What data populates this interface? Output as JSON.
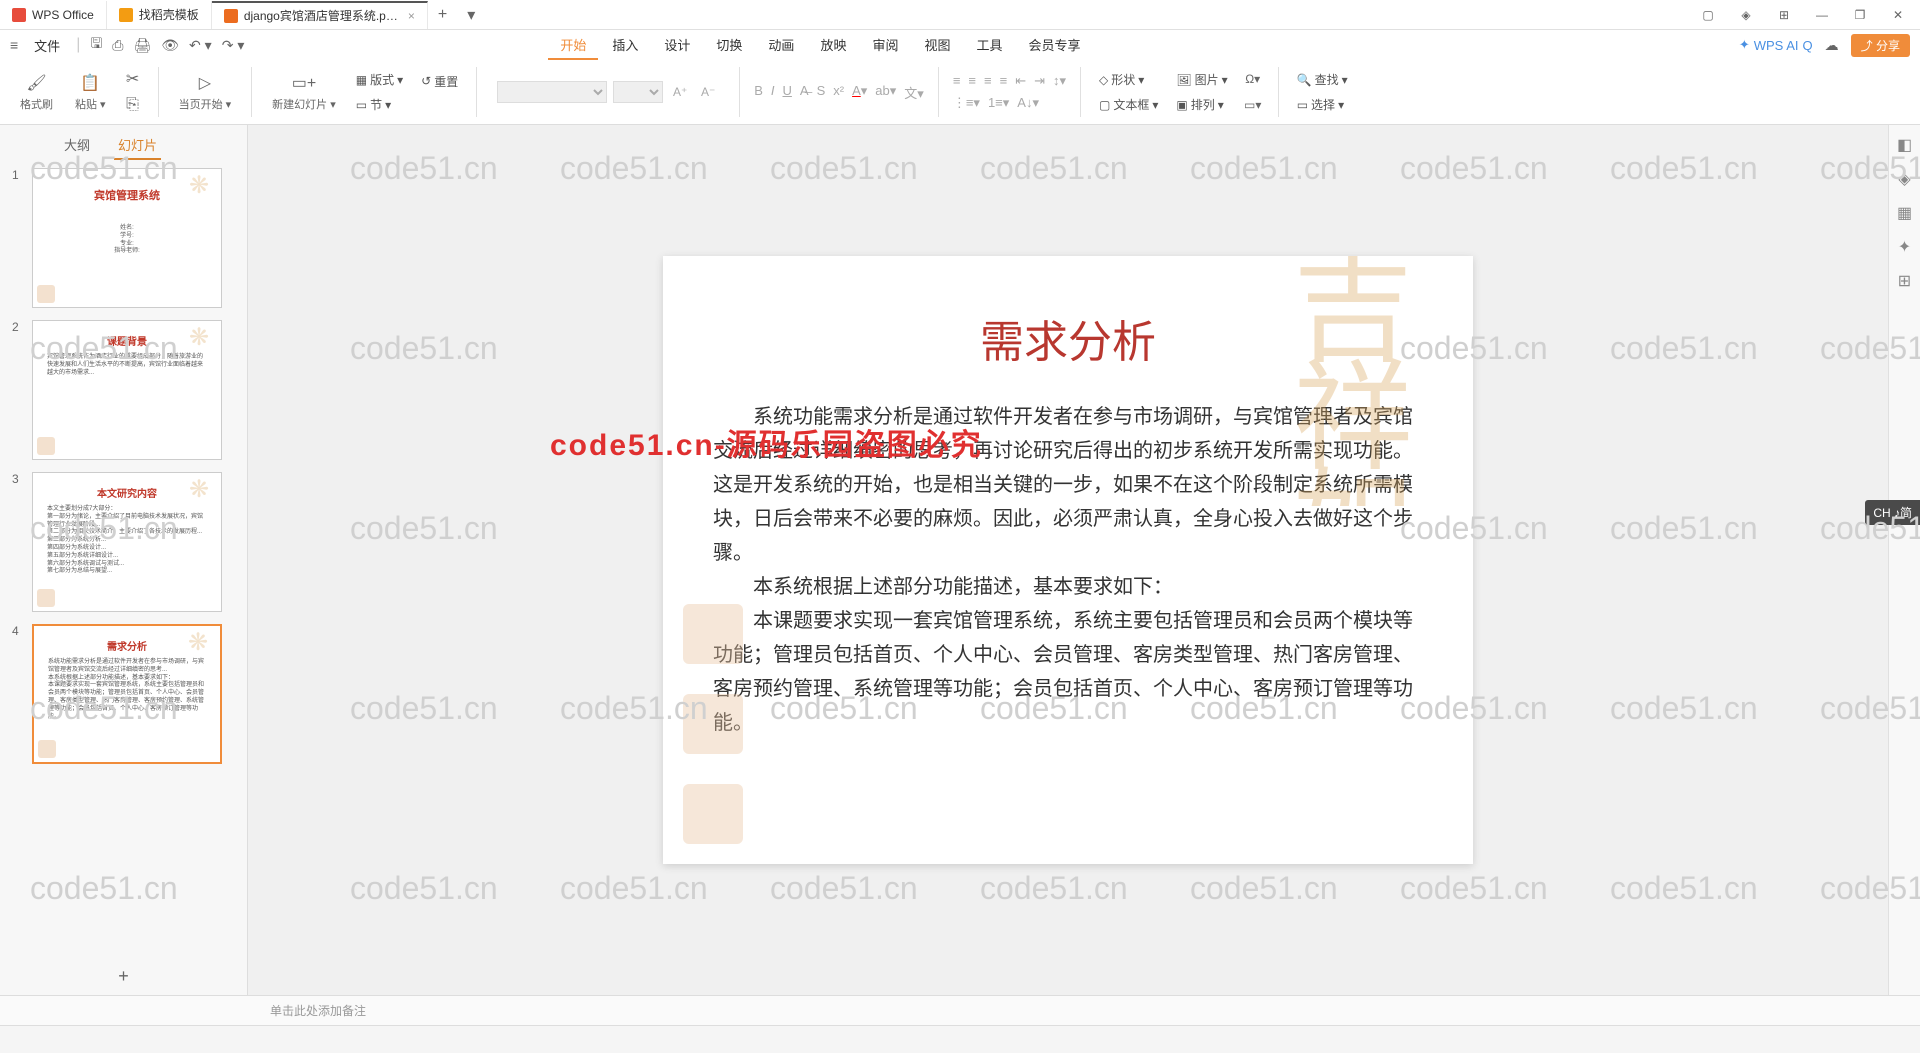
{
  "titlebar": {
    "tabs": [
      {
        "label": "WPS Office",
        "icon": "wps"
      },
      {
        "label": "找稻壳模板",
        "icon": "daoqiao"
      },
      {
        "label": "django宾馆酒店管理系统.p…",
        "icon": "ppt",
        "active": true
      }
    ]
  },
  "menu": {
    "file": "文件",
    "tabs": [
      "开始",
      "插入",
      "设计",
      "切换",
      "动画",
      "放映",
      "审阅",
      "视图",
      "工具",
      "会员专享"
    ],
    "active_tab": "开始",
    "wps_ai": "WPS AI",
    "share": "分享"
  },
  "ribbon": {
    "format_painter": "格式刷",
    "paste": "粘贴",
    "current_page": "当页开始",
    "new_slide": "新建幻灯片",
    "layout": "版式",
    "section": "节",
    "reset": "重置",
    "shape": "形状",
    "picture": "图片",
    "textbox": "文本框",
    "arrange": "排列",
    "find": "查找",
    "select": "选择"
  },
  "sidebar": {
    "tab_outline": "大纲",
    "tab_slides": "幻灯片",
    "thumbs": [
      {
        "num": "1",
        "title": "宾馆管理系统",
        "sub": "姓名:\n学号:\n专业:\n指导老师:"
      },
      {
        "num": "2",
        "title": "课题背景"
      },
      {
        "num": "3",
        "title": "本文研究内容"
      },
      {
        "num": "4",
        "title": "需求分析",
        "active": true
      }
    ]
  },
  "slide": {
    "title": "需求分析",
    "para1": "系统功能需求分析是通过软件开发者在参与市场调研，与宾馆管理者及宾馆交流后经过详细缜密的思考，再讨论研究后得出的初步系统开发所需实现功能。这是开发系统的开始，也是相当关键的一步，如果不在这个阶段制定系统所需模块，日后会带来不必要的麻烦。因此，必须严肃认真，全身心投入去做好这个步骤。",
    "para2": "本系统根据上述部分功能描述，基本要求如下：",
    "para3": "本课题要求实现一套宾馆管理系统，系统主要包括管理员和会员两个模块等功能；管理员包括首页、个人中心、会员管理、客房类型管理、热门客房管理、客房预约管理、系统管理等功能；会员包括首页、个人中心、客房预订管理等功能。"
  },
  "watermarks": {
    "text": "code51.cn",
    "red_text": "code51.cn-源码乐园盗图必究"
  },
  "notes": {
    "placeholder": "单击此处添加备注"
  },
  "ime": {
    "label": "CH ♪简"
  }
}
